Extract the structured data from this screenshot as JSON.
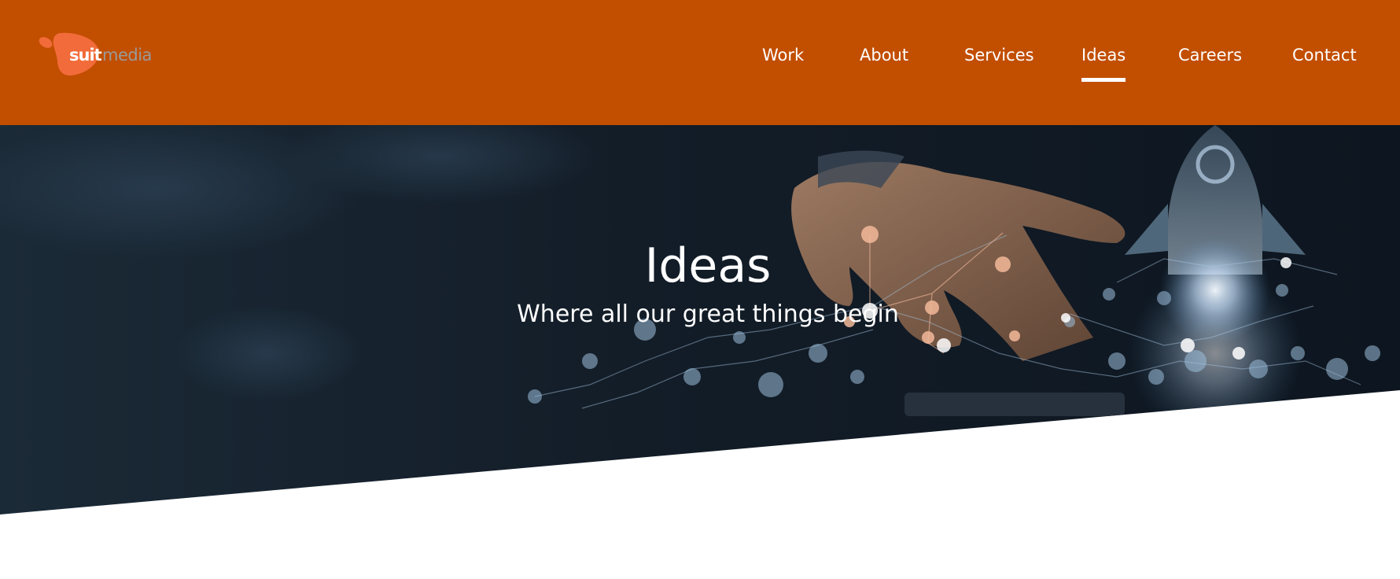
{
  "brand": {
    "logo_primary": "suit",
    "logo_secondary": "media",
    "header_color": "#c24e00",
    "logo_blob_color": "#f26b3a",
    "logo_media_color": "#9a9a9a"
  },
  "nav": {
    "items": [
      {
        "label": "Work",
        "active": false
      },
      {
        "label": "About",
        "active": false
      },
      {
        "label": "Services",
        "active": false
      },
      {
        "label": "Ideas",
        "active": true
      },
      {
        "label": "Careers",
        "active": false
      },
      {
        "label": "Contact",
        "active": false
      }
    ]
  },
  "hero": {
    "title": "Ideas",
    "subtitle": "Where all our great things begin",
    "background_image": "hand-touching-tablet-with-rocket-and-network-graphic",
    "overlay_color": "#16222e"
  }
}
